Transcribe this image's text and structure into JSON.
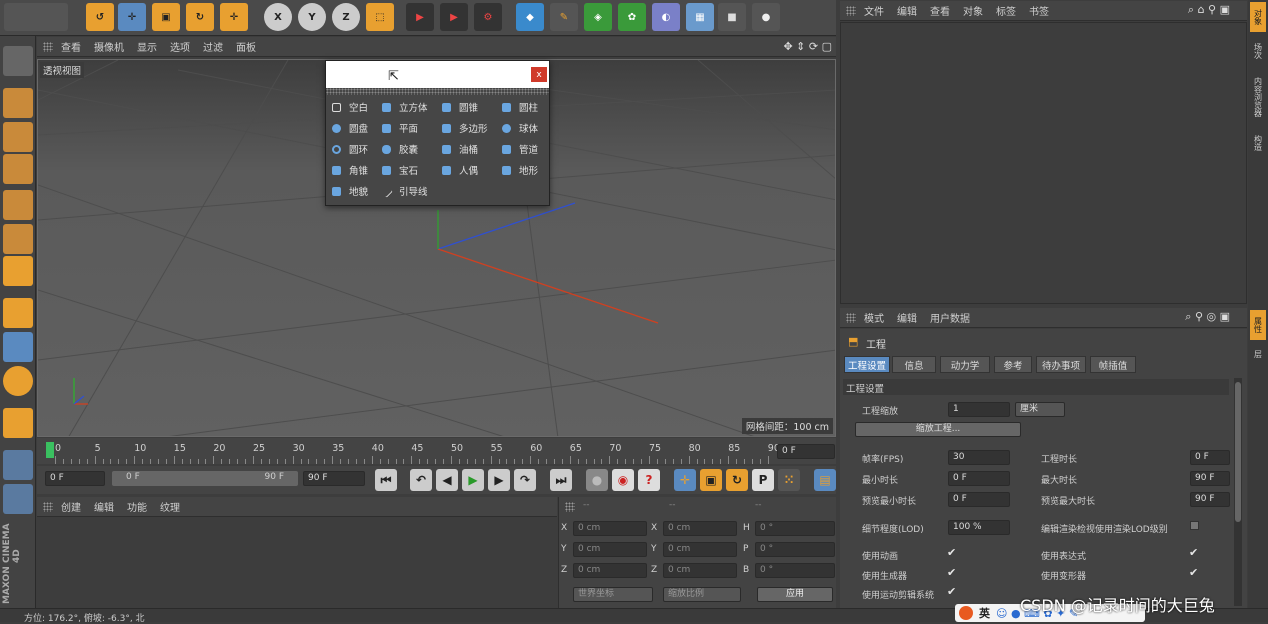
{
  "toolbar": {
    "x": "X",
    "y": "Y",
    "z": "Z"
  },
  "viewport": {
    "menu": [
      "查看",
      "摄像机",
      "显示",
      "选项",
      "过滤",
      "面板"
    ],
    "name": "透视视图",
    "grid_info": "网格间距：100 cm"
  },
  "popup": {
    "close": "x",
    "items": [
      [
        "空白",
        "立方体",
        "圆锥",
        "圆柱"
      ],
      [
        "圆盘",
        "平面",
        "多边形",
        "球体"
      ],
      [
        "圆环",
        "胶囊",
        "油桶",
        "管道"
      ],
      [
        "角锥",
        "宝石",
        "人偶",
        "地形"
      ],
      [
        "地貌",
        "引导线"
      ]
    ]
  },
  "timeline": {
    "ticks": [
      "0",
      "5",
      "10",
      "15",
      "20",
      "25",
      "30",
      "35",
      "40",
      "45",
      "50",
      "55",
      "60",
      "65",
      "70",
      "75",
      "80",
      "85",
      "90"
    ],
    "current": "0 F",
    "start": "0 F",
    "range_start": "0 F",
    "range_end": "90 F",
    "end": "90 F"
  },
  "material": {
    "menu": [
      "创建",
      "编辑",
      "功能",
      "纹理"
    ]
  },
  "coords": {
    "header": [
      "--",
      "--",
      "--"
    ],
    "rows": [
      [
        "X",
        "0 cm",
        "X",
        "0 cm",
        "H",
        "0 °"
      ],
      [
        "Y",
        "0 cm",
        "Y",
        "0 cm",
        "P",
        "0 °"
      ],
      [
        "Z",
        "0 cm",
        "Z",
        "0 cm",
        "B",
        "0 °"
      ]
    ],
    "world": "世界坐标",
    "scale": "缩放比例",
    "apply": "应用"
  },
  "objects": {
    "menu": [
      "文件",
      "编辑",
      "查看",
      "对象",
      "标签",
      "书签"
    ]
  },
  "attributes": {
    "menu": [
      "模式",
      "编辑",
      "用户数据"
    ],
    "title": "工程",
    "tabs": [
      "工程设置",
      "信息",
      "动力学",
      "参考",
      "待办事项",
      "帧插值"
    ],
    "section": "工程设置",
    "scale_label": "工程缩放",
    "scale_value": "1",
    "scale_unit": "厘米",
    "scale_button": "缩放工程...",
    "fps_label": "帧率(FPS)",
    "fps": "30",
    "dur_label": "工程时长",
    "dur": "0 F",
    "min_label": "最小时长",
    "min": "0 F",
    "max_label": "最大时长",
    "max": "90 F",
    "pmin_label": "预览最小时长",
    "pmin": "0 F",
    "pmax_label": "预览最大时长",
    "pmax": "90 F",
    "lod_label": "细节程度(LOD)",
    "lod": "100 %",
    "lod_render": "编辑渲染检视使用渲染LOD级别",
    "checks": [
      [
        "使用动画",
        "✔",
        "使用表达式",
        "✔"
      ],
      [
        "使用生成器",
        "✔",
        "使用变形器",
        "✔"
      ],
      [
        "使用运动剪辑系统",
        "✔",
        "",
        ""
      ]
    ]
  },
  "side_tabs_right": [
    "对象",
    "场次",
    "内容浏览器",
    "构造"
  ],
  "side_tabs_right2": [
    "属性",
    "层"
  ],
  "brand": {
    "maxon": "MAXON",
    "c4d": "CINEMA 4D"
  },
  "status": {
    "text": "方位: 176.2°, 俯坡: -6.3°, 北"
  },
  "ime": {
    "lang": "英"
  },
  "watermark": "CSDN @记录时间的大巨兔",
  "colors": {
    "accent": "#f0a030",
    "selected_btn": "#5a8ac0",
    "x_axis": "#d04020",
    "y_axis": "#30b030",
    "z_axis": "#3050d0"
  }
}
